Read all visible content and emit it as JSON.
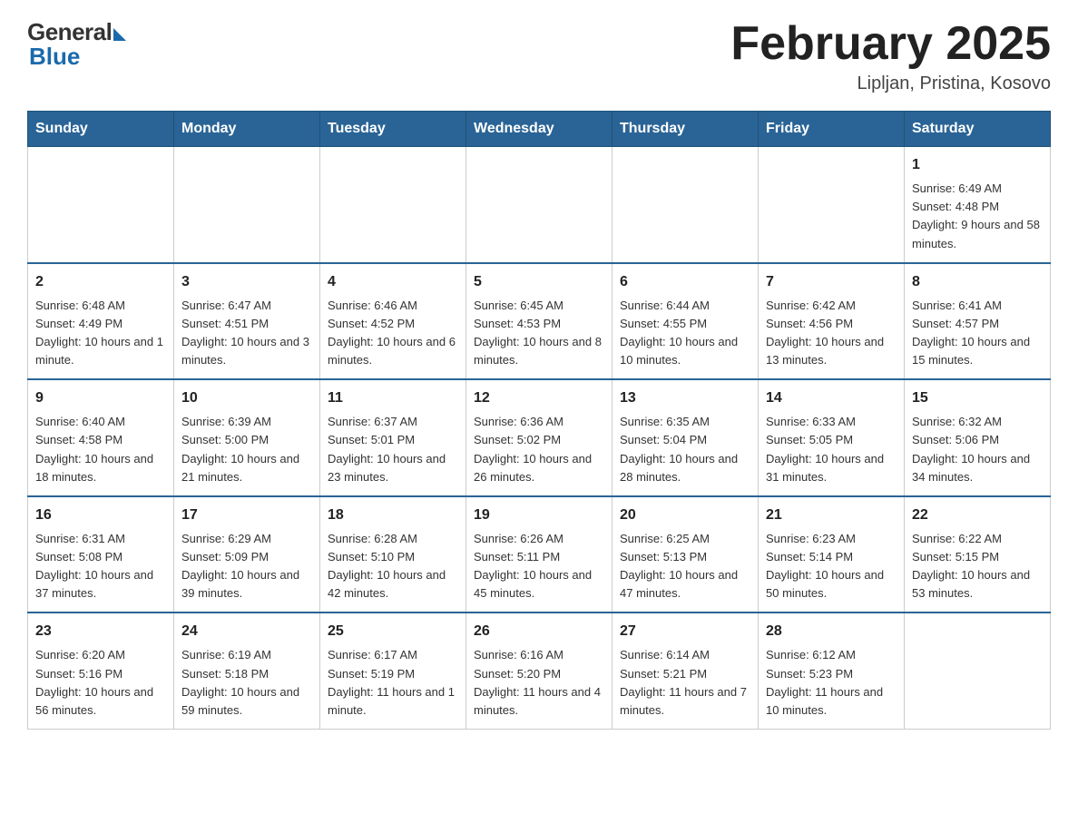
{
  "logo": {
    "general": "General",
    "blue": "Blue"
  },
  "title": "February 2025",
  "subtitle": "Lipljan, Pristina, Kosovo",
  "days_header": [
    "Sunday",
    "Monday",
    "Tuesday",
    "Wednesday",
    "Thursday",
    "Friday",
    "Saturday"
  ],
  "weeks": [
    [
      {
        "num": "",
        "info": ""
      },
      {
        "num": "",
        "info": ""
      },
      {
        "num": "",
        "info": ""
      },
      {
        "num": "",
        "info": ""
      },
      {
        "num": "",
        "info": ""
      },
      {
        "num": "",
        "info": ""
      },
      {
        "num": "1",
        "info": "Sunrise: 6:49 AM\nSunset: 4:48 PM\nDaylight: 9 hours and 58 minutes."
      }
    ],
    [
      {
        "num": "2",
        "info": "Sunrise: 6:48 AM\nSunset: 4:49 PM\nDaylight: 10 hours and 1 minute."
      },
      {
        "num": "3",
        "info": "Sunrise: 6:47 AM\nSunset: 4:51 PM\nDaylight: 10 hours and 3 minutes."
      },
      {
        "num": "4",
        "info": "Sunrise: 6:46 AM\nSunset: 4:52 PM\nDaylight: 10 hours and 6 minutes."
      },
      {
        "num": "5",
        "info": "Sunrise: 6:45 AM\nSunset: 4:53 PM\nDaylight: 10 hours and 8 minutes."
      },
      {
        "num": "6",
        "info": "Sunrise: 6:44 AM\nSunset: 4:55 PM\nDaylight: 10 hours and 10 minutes."
      },
      {
        "num": "7",
        "info": "Sunrise: 6:42 AM\nSunset: 4:56 PM\nDaylight: 10 hours and 13 minutes."
      },
      {
        "num": "8",
        "info": "Sunrise: 6:41 AM\nSunset: 4:57 PM\nDaylight: 10 hours and 15 minutes."
      }
    ],
    [
      {
        "num": "9",
        "info": "Sunrise: 6:40 AM\nSunset: 4:58 PM\nDaylight: 10 hours and 18 minutes."
      },
      {
        "num": "10",
        "info": "Sunrise: 6:39 AM\nSunset: 5:00 PM\nDaylight: 10 hours and 21 minutes."
      },
      {
        "num": "11",
        "info": "Sunrise: 6:37 AM\nSunset: 5:01 PM\nDaylight: 10 hours and 23 minutes."
      },
      {
        "num": "12",
        "info": "Sunrise: 6:36 AM\nSunset: 5:02 PM\nDaylight: 10 hours and 26 minutes."
      },
      {
        "num": "13",
        "info": "Sunrise: 6:35 AM\nSunset: 5:04 PM\nDaylight: 10 hours and 28 minutes."
      },
      {
        "num": "14",
        "info": "Sunrise: 6:33 AM\nSunset: 5:05 PM\nDaylight: 10 hours and 31 minutes."
      },
      {
        "num": "15",
        "info": "Sunrise: 6:32 AM\nSunset: 5:06 PM\nDaylight: 10 hours and 34 minutes."
      }
    ],
    [
      {
        "num": "16",
        "info": "Sunrise: 6:31 AM\nSunset: 5:08 PM\nDaylight: 10 hours and 37 minutes."
      },
      {
        "num": "17",
        "info": "Sunrise: 6:29 AM\nSunset: 5:09 PM\nDaylight: 10 hours and 39 minutes."
      },
      {
        "num": "18",
        "info": "Sunrise: 6:28 AM\nSunset: 5:10 PM\nDaylight: 10 hours and 42 minutes."
      },
      {
        "num": "19",
        "info": "Sunrise: 6:26 AM\nSunset: 5:11 PM\nDaylight: 10 hours and 45 minutes."
      },
      {
        "num": "20",
        "info": "Sunrise: 6:25 AM\nSunset: 5:13 PM\nDaylight: 10 hours and 47 minutes."
      },
      {
        "num": "21",
        "info": "Sunrise: 6:23 AM\nSunset: 5:14 PM\nDaylight: 10 hours and 50 minutes."
      },
      {
        "num": "22",
        "info": "Sunrise: 6:22 AM\nSunset: 5:15 PM\nDaylight: 10 hours and 53 minutes."
      }
    ],
    [
      {
        "num": "23",
        "info": "Sunrise: 6:20 AM\nSunset: 5:16 PM\nDaylight: 10 hours and 56 minutes."
      },
      {
        "num": "24",
        "info": "Sunrise: 6:19 AM\nSunset: 5:18 PM\nDaylight: 10 hours and 59 minutes."
      },
      {
        "num": "25",
        "info": "Sunrise: 6:17 AM\nSunset: 5:19 PM\nDaylight: 11 hours and 1 minute."
      },
      {
        "num": "26",
        "info": "Sunrise: 6:16 AM\nSunset: 5:20 PM\nDaylight: 11 hours and 4 minutes."
      },
      {
        "num": "27",
        "info": "Sunrise: 6:14 AM\nSunset: 5:21 PM\nDaylight: 11 hours and 7 minutes."
      },
      {
        "num": "28",
        "info": "Sunrise: 6:12 AM\nSunset: 5:23 PM\nDaylight: 11 hours and 10 minutes."
      },
      {
        "num": "",
        "info": ""
      }
    ]
  ]
}
